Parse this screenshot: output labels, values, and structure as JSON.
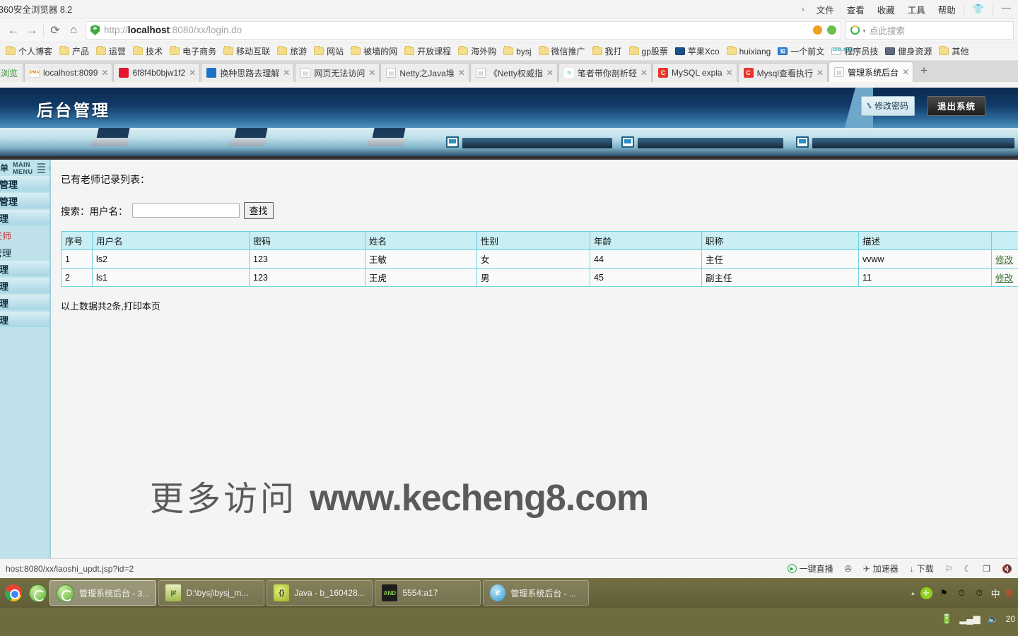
{
  "browser": {
    "title": "360安全浏览器 8.2",
    "menu_chevron": "›",
    "menu_items": [
      "文件",
      "查看",
      "收藏",
      "工具",
      "帮助"
    ],
    "shirt_icon": "👕",
    "minimize": "—",
    "nav": {
      "back": "←",
      "forward": "→",
      "reload": "⟳",
      "home": "⌂"
    },
    "url": {
      "scheme": "http://",
      "host": "localhost",
      "path": ":8080/xx/login.do",
      "full": "http://localhost:8080/xx/login.do"
    },
    "search": {
      "placeholder": "点此搜索"
    },
    "bookmarks": [
      {
        "label": "个人博客",
        "icon": "folder-icon",
        "style": "folder"
      },
      {
        "label": "产品",
        "icon": "folder-icon",
        "style": "folder"
      },
      {
        "label": "运营",
        "icon": "folder-icon",
        "style": "folder"
      },
      {
        "label": "技术",
        "icon": "folder-icon",
        "style": "folder"
      },
      {
        "label": "电子商务",
        "icon": "folder-icon",
        "style": "folder"
      },
      {
        "label": "移动互联",
        "icon": "folder-icon",
        "style": "folder"
      },
      {
        "label": "旅游",
        "icon": "folder-icon",
        "style": "folder"
      },
      {
        "label": "网站",
        "icon": "folder-icon",
        "style": "folder"
      },
      {
        "label": "被墙的网",
        "icon": "folder-icon",
        "style": "folder"
      },
      {
        "label": "开放课程",
        "icon": "folder-icon",
        "style": "folder"
      },
      {
        "label": "海外购",
        "icon": "folder-icon",
        "style": "folder"
      },
      {
        "label": "bysj",
        "icon": "folder-icon",
        "style": "folder"
      },
      {
        "label": "微信推广",
        "icon": "folder-icon",
        "style": "folder"
      },
      {
        "label": "我打",
        "icon": "folder-icon",
        "style": "folder"
      },
      {
        "label": "gp股票",
        "icon": "folder-icon",
        "style": "folder"
      },
      {
        "label": "苹果Xco",
        "icon": "site-icon",
        "style": "darkblue",
        "glyph": ""
      },
      {
        "label": "huixiang",
        "icon": "folder-icon",
        "style": "folder"
      },
      {
        "label": "一个前文",
        "icon": "zhihu-icon",
        "style": "blue",
        "glyph": "知"
      },
      {
        "label": "程序员技",
        "icon": "coolshell-icon",
        "style": "cool",
        "glyph": "COOL SHELL"
      },
      {
        "label": "健身资源",
        "icon": "site-icon",
        "style": "gray",
        "glyph": ""
      },
      {
        "label": "其他",
        "icon": "folder-icon",
        "style": "folder"
      }
    ],
    "pinned_tab_label": "屏浏览",
    "tabs": [
      {
        "label": "localhost:8099",
        "favicon": "pma",
        "glyph": "PMA",
        "active": false
      },
      {
        "label": "6f8f4b0bjw1f2",
        "favicon": "weibo",
        "glyph": "",
        "active": false
      },
      {
        "label": "换种思路去理解",
        "favicon": "blue",
        "glyph": "",
        "active": false
      },
      {
        "label": "网页无法访问",
        "favicon": "doc",
        "glyph": "▤",
        "active": false
      },
      {
        "label": "Netty之Java堆",
        "favicon": "doc",
        "glyph": "▤",
        "active": false
      },
      {
        "label": "《Netty权威指",
        "favicon": "doc",
        "glyph": "▤",
        "active": false
      },
      {
        "label": "笔者带你剖析轻",
        "favicon": "teal",
        "glyph": "≈",
        "active": false
      },
      {
        "label": "MySQL expla",
        "favicon": "mysql",
        "glyph": "C",
        "active": false
      },
      {
        "label": "Mysql查看执行",
        "favicon": "mysql",
        "glyph": "C",
        "active": false
      },
      {
        "label": "管理系统后台",
        "favicon": "doc",
        "glyph": "▤",
        "active": true
      }
    ],
    "tab_close": "✕",
    "new_tab": "+",
    "status_url": "host:8080/xx/laoshi_updt.jsp?id=2",
    "status_items": [
      {
        "label": "一键直播",
        "icon": "live-play-icon"
      },
      {
        "label": "",
        "icon": "speed-dial-icon"
      },
      {
        "label": "加速器",
        "icon": "rocket-icon"
      },
      {
        "label": "下载",
        "icon": "download-arrow-icon"
      },
      {
        "label": "",
        "icon": "flag-icon"
      },
      {
        "label": "",
        "icon": "moon-icon"
      },
      {
        "label": "",
        "icon": "window-icon"
      },
      {
        "label": "",
        "icon": "mute-icon"
      }
    ]
  },
  "site": {
    "title": "后台管理",
    "change_password": "修改密码",
    "exit_system": "退出系统",
    "menu_cn": "单",
    "menu_en": "MAIN MENU",
    "nav_top": [
      {
        "label": "员管理",
        "type": "group"
      },
      {
        "label": "户管理",
        "type": "group"
      },
      {
        "label": "管理",
        "type": "group"
      },
      {
        "label": "老师",
        "type": "link-active"
      },
      {
        "label": "管理",
        "type": "link"
      }
    ],
    "nav_bottom": [
      {
        "label": "管理",
        "type": "group"
      },
      {
        "label": "管理",
        "type": "group"
      },
      {
        "label": "管理",
        "type": "group"
      },
      {
        "label": "管理",
        "type": "group"
      }
    ]
  },
  "main": {
    "list_title": "已有老师记录列表：",
    "search_label": "搜索：用户名：",
    "search_value": "",
    "search_button": "查找",
    "columns": [
      "序号",
      "用户名",
      "密码",
      "姓名",
      "性别",
      "年龄",
      "职称",
      "描述",
      ""
    ],
    "rows": [
      {
        "seq": "1",
        "username": "ls2",
        "password": "123",
        "name": "王敏",
        "gender": "女",
        "age": "44",
        "title": "主任",
        "desc": "vvww",
        "action": "修改"
      },
      {
        "seq": "2",
        "username": "ls1",
        "password": "123",
        "name": "王虎",
        "gender": "男",
        "age": "45",
        "title": "副主任",
        "desc": "11",
        "action": "修改"
      }
    ],
    "total_text": "以上数据共2条,打印本页",
    "watermark_cn": "更多访问",
    "watermark_en": "www.kecheng8.com"
  },
  "taskbar": {
    "quick": [
      {
        "name": "chrome-icon",
        "label": ""
      },
      {
        "name": "browser360-icon",
        "label": ""
      }
    ],
    "tasks": [
      {
        "label": "管理系统后台 - 3...",
        "icon": "browser360-icon",
        "active": true
      },
      {
        "label": "D:\\bysj\\bysj_m...",
        "icon": "editplus-icon",
        "active": false
      },
      {
        "label": "Java - b_160428...",
        "icon": "eclipse-icon",
        "active": false
      },
      {
        "label": "5554:a17",
        "icon": "android-emulator-icon",
        "active": false
      },
      {
        "label": "管理系统后台 - ...",
        "icon": "ie-icon",
        "active": false
      }
    ],
    "tray": {
      "caret": "▴",
      "icons": [
        "plus-circle-icon",
        "flag-blocked-icon",
        "clock-user-icon",
        "clock-user-icon"
      ],
      "ime": "中",
      "sogou": "S",
      "row2_icons": [
        "battery-icon",
        "signal-icon",
        "volume-mute-icon"
      ],
      "time": "20"
    }
  }
}
